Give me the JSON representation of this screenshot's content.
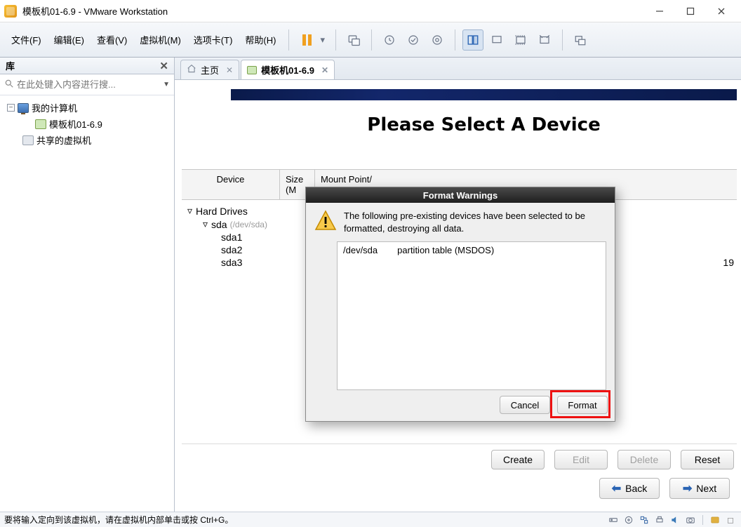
{
  "window": {
    "title": "模板机01-6.9 - VMware Workstation"
  },
  "menu": {
    "file": "文件(F)",
    "edit": "编辑(E)",
    "view": "查看(V)",
    "vm": "虚拟机(M)",
    "tabs": "选项卡(T)",
    "help": "帮助(H)"
  },
  "sidebar": {
    "title": "库",
    "search_placeholder": "在此处键入内容进行搜...",
    "root": "我的计算机",
    "vm": "模板机01-6.9",
    "shared": "共享的虚拟机"
  },
  "tabs": {
    "home": "主页",
    "vm": "模板机01-6.9"
  },
  "installer": {
    "heading": "Please Select A Device",
    "columns": {
      "device": "Device",
      "size": "Size\n(M",
      "mount": "Mount Point/"
    },
    "tree": {
      "hard_drives": "Hard Drives",
      "sda": "sda",
      "sda_hint": "(/dev/sda)",
      "sda1": "sda1",
      "sda2": "sda2",
      "sda3": "sda3",
      "sda3_size": "19"
    },
    "buttons": {
      "create": "Create",
      "edit": "Edit",
      "delete": "Delete",
      "reset": "Reset"
    },
    "nav": {
      "back": "Back",
      "next": "Next"
    }
  },
  "dialog": {
    "title": "Format Warnings",
    "message": "The following pre-existing devices have been selected to be formatted, destroying all data.",
    "items": [
      {
        "dev": "/dev/sda",
        "desc": "partition table (MSDOS)"
      }
    ],
    "cancel": "Cancel",
    "format": "Format"
  },
  "statusbar": {
    "text": "要将输入定向到该虚拟机，请在虚拟机内部单击或按 Ctrl+G。"
  }
}
